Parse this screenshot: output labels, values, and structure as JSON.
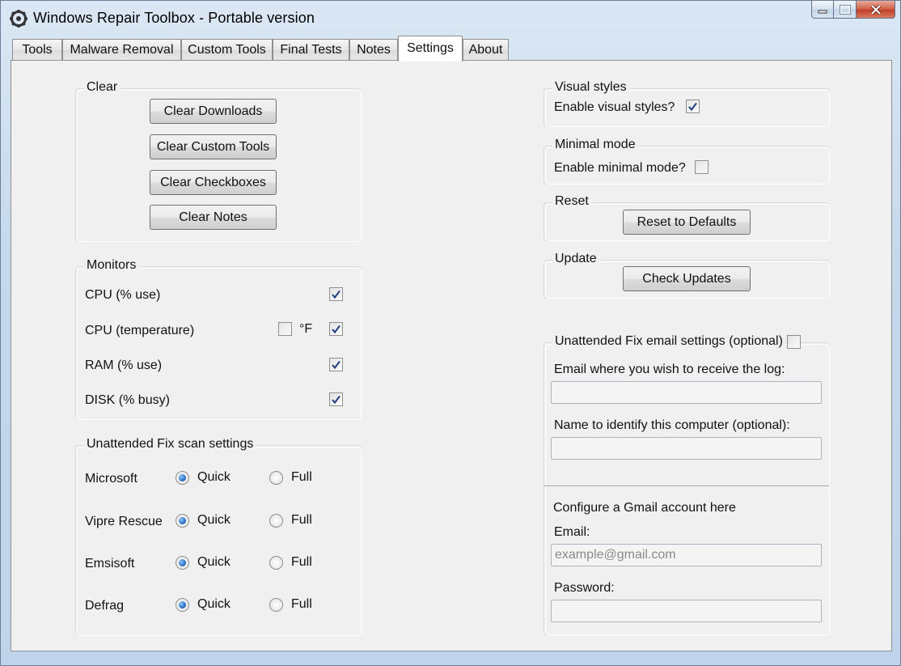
{
  "window": {
    "title": "Windows Repair Toolbox - Portable version",
    "icon": "gear-icon"
  },
  "tabs": [
    {
      "label": "Tools",
      "active": false
    },
    {
      "label": "Malware Removal",
      "active": false
    },
    {
      "label": "Custom Tools",
      "active": false
    },
    {
      "label": "Final Tests",
      "active": false
    },
    {
      "label": "Notes",
      "active": false
    },
    {
      "label": "Settings",
      "active": true
    },
    {
      "label": "About",
      "active": false
    }
  ],
  "clear": {
    "title": "Clear",
    "buttons": [
      "Clear Downloads",
      "Clear Custom Tools",
      "Clear Checkboxes",
      "Clear Notes"
    ]
  },
  "monitors": {
    "title": "Monitors",
    "fahrenheit_label": "°F",
    "fahrenheit_checked": false,
    "items": [
      {
        "label": "CPU (% use)",
        "checked": true
      },
      {
        "label": "CPU (temperature)",
        "checked": true
      },
      {
        "label": "RAM (% use)",
        "checked": true
      },
      {
        "label": "DISK (% busy)",
        "checked": true
      }
    ]
  },
  "scan": {
    "title": "Unattended Fix scan settings",
    "quick_label": "Quick",
    "full_label": "Full",
    "rows": [
      {
        "label": "Microsoft",
        "selected": "Quick"
      },
      {
        "label": "Vipre Rescue",
        "selected": "Quick"
      },
      {
        "label": "Emsisoft",
        "selected": "Quick"
      },
      {
        "label": "Defrag",
        "selected": "Quick"
      }
    ]
  },
  "visual_styles": {
    "title": "Visual styles",
    "label": "Enable visual styles?",
    "checked": true
  },
  "minimal_mode": {
    "title": "Minimal mode",
    "label": "Enable minimal mode?",
    "checked": false
  },
  "reset": {
    "title": "Reset",
    "button": "Reset to Defaults"
  },
  "update": {
    "title": "Update",
    "button": "Check Updates"
  },
  "email": {
    "title": "Unattended Fix email settings (optional)",
    "enabled": false,
    "receive_label": "Email where you wish to receive the log:",
    "receive_value": "",
    "computer_label": "Name to identify this computer (optional):",
    "computer_value": "",
    "gmail_heading": "Configure a Gmail account here",
    "gmail_email_label": "Email:",
    "gmail_email_placeholder": "example@gmail.com",
    "gmail_password_label": "Password:",
    "gmail_password_value": ""
  },
  "colors": {
    "radio_selected": "#2d71c4",
    "check_mark": "#1f3f7a",
    "close_button": "#c0402a"
  }
}
